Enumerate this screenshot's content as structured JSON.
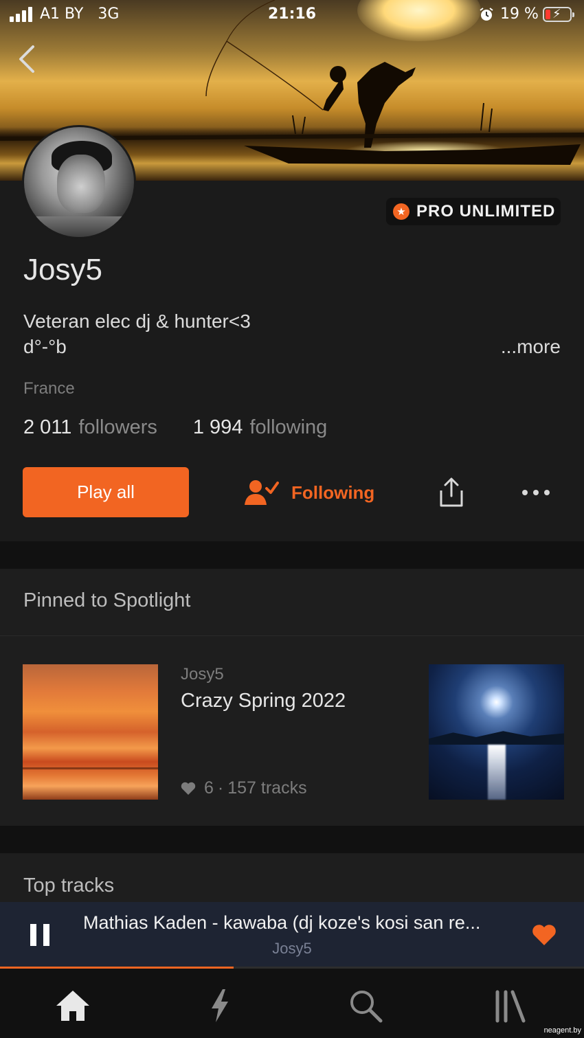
{
  "status_bar": {
    "carrier": "A1 BY",
    "network": "3G",
    "time": "21:16",
    "battery_percent": "19 %"
  },
  "profile": {
    "name": "Josy5",
    "badge": "PRO UNLIMITED",
    "bio_line1": "Veteran elec dj & hunter<3",
    "bio_line2": "d°-°b",
    "more_label": "...more",
    "country": "France",
    "followers_count": "2 011",
    "followers_label": "followers",
    "following_count": "1 994",
    "following_label": "following"
  },
  "actions": {
    "play_all": "Play all",
    "following": "Following"
  },
  "spotlight": {
    "title": "Pinned to Spotlight",
    "item": {
      "user": "Josy5",
      "title": "Crazy Spring 2022",
      "likes": "6",
      "tracks": "157 tracks",
      "meta_sep": "·"
    }
  },
  "top_tracks": {
    "title": "Top tracks"
  },
  "player": {
    "track_title": "Mathias Kaden - kawaba (dj koze's kosi san re...",
    "artist": "Josy5",
    "progress": 0.4
  },
  "tabs": [
    "home-icon",
    "stream-icon",
    "search-icon",
    "library-icon"
  ],
  "watermark": "neagent.by",
  "colors": {
    "accent": "#f26522",
    "background": "#1b1b1b",
    "player_bg": "#1e2433"
  }
}
